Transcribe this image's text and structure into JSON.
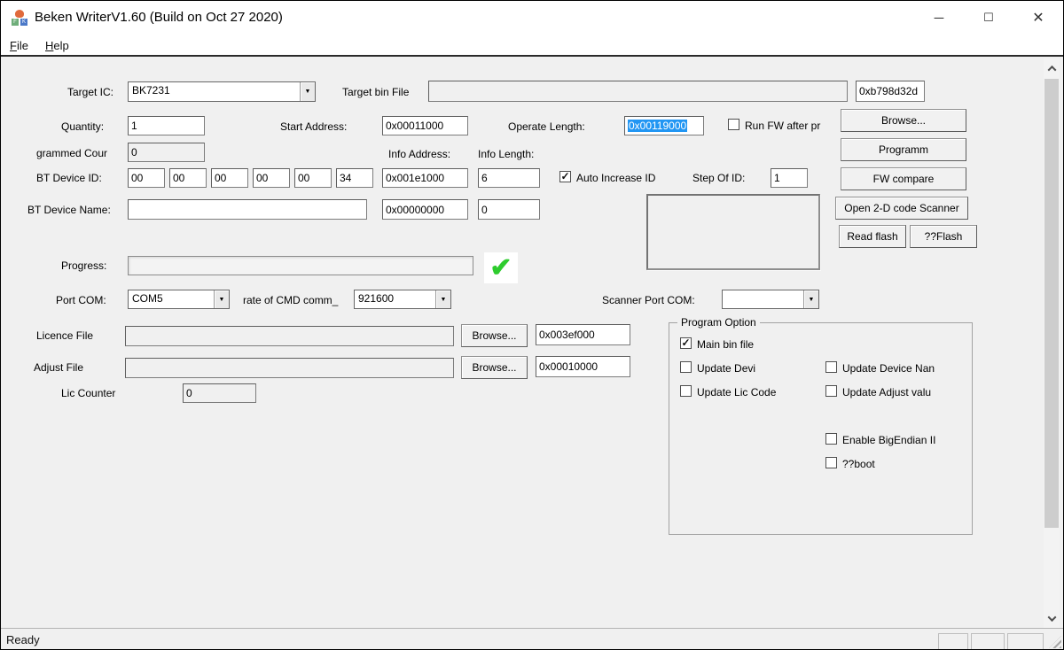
{
  "window": {
    "title": "Beken WriterV1.60 (Build on Oct 27 2020)",
    "controls": {
      "minimize": "─",
      "maximize": "☐",
      "close": "✕"
    }
  },
  "menu": {
    "file": "File",
    "help": "Help"
  },
  "main": {
    "target_ic": {
      "label": "Target IC:",
      "value": "BK7231"
    },
    "target_bin": {
      "label": "Target bin File",
      "value": ""
    },
    "checksum": "0xb798d32d",
    "quantity": {
      "label": "Quantity:",
      "value": "1"
    },
    "start_address": {
      "label": "Start Address:",
      "value": "0x00011000"
    },
    "operate_length": {
      "label": "Operate Length:",
      "value": "0x00119000"
    },
    "run_fw": {
      "label": "Run FW after pr",
      "checked": false
    },
    "programmed_count": {
      "label": "grammed Cour",
      "value": "0"
    },
    "info_address": {
      "label": "Info Address:",
      "value": "0x001e1000"
    },
    "info_length": {
      "label": "Info Length:",
      "value": "6"
    },
    "bt_device_id": {
      "label": "BT Device ID:",
      "values": [
        "00",
        "00",
        "00",
        "00",
        "00",
        "34"
      ]
    },
    "auto_increase": {
      "label": "Auto Increase ID",
      "checked": true
    },
    "step_of_id": {
      "label": "Step Of ID:",
      "value": "1"
    },
    "bt_device_name": {
      "label": "BT Device Name:",
      "value": "",
      "addr": "0x00000000",
      "len": "0"
    },
    "progress_label": "Progress:",
    "port_com": {
      "label": "Port COM:",
      "value": "COM5"
    },
    "cmd_rate": {
      "label": "rate of CMD comm_",
      "value": "921600"
    },
    "scanner_port": {
      "label": "Scanner Port COM:",
      "value": ""
    },
    "licence": {
      "label": "Licence File",
      "value": "",
      "browse": "Browse...",
      "address": "0x003ef000"
    },
    "adjust": {
      "label": "Adjust File",
      "value": "",
      "browse": "Browse...",
      "address": "0x00010000"
    },
    "lic_counter": {
      "label": "Lic Counter",
      "value": "0"
    },
    "buttons": {
      "browse": "Browse...",
      "program": "Programm",
      "fw_compare": "FW compare",
      "open_scanner": "Open 2-D code Scanner",
      "read_flash": "Read flash",
      "erase_flash": "??Flash"
    }
  },
  "program_option": {
    "title": "Program Option",
    "options": [
      {
        "label": "Main bin file",
        "checked": true
      },
      {
        "label": "Update Devi",
        "checked": false
      },
      {
        "label": "Update Device Nan",
        "checked": false
      },
      {
        "label": "Update Lic Code",
        "checked": false
      },
      {
        "label": "Update Adjust valu",
        "checked": false
      },
      {
        "label": "Enable BigEndian II",
        "checked": false
      },
      {
        "label": "??boot",
        "checked": false
      }
    ]
  },
  "status": {
    "text": "Ready"
  },
  "icons": {
    "dropdown": "▼",
    "check": "✓",
    "success_check": "✔"
  },
  "colors": {
    "selection": "#2196f3",
    "success_green": "#2ecc2e",
    "thumb_grey": "#cdcdcd"
  }
}
